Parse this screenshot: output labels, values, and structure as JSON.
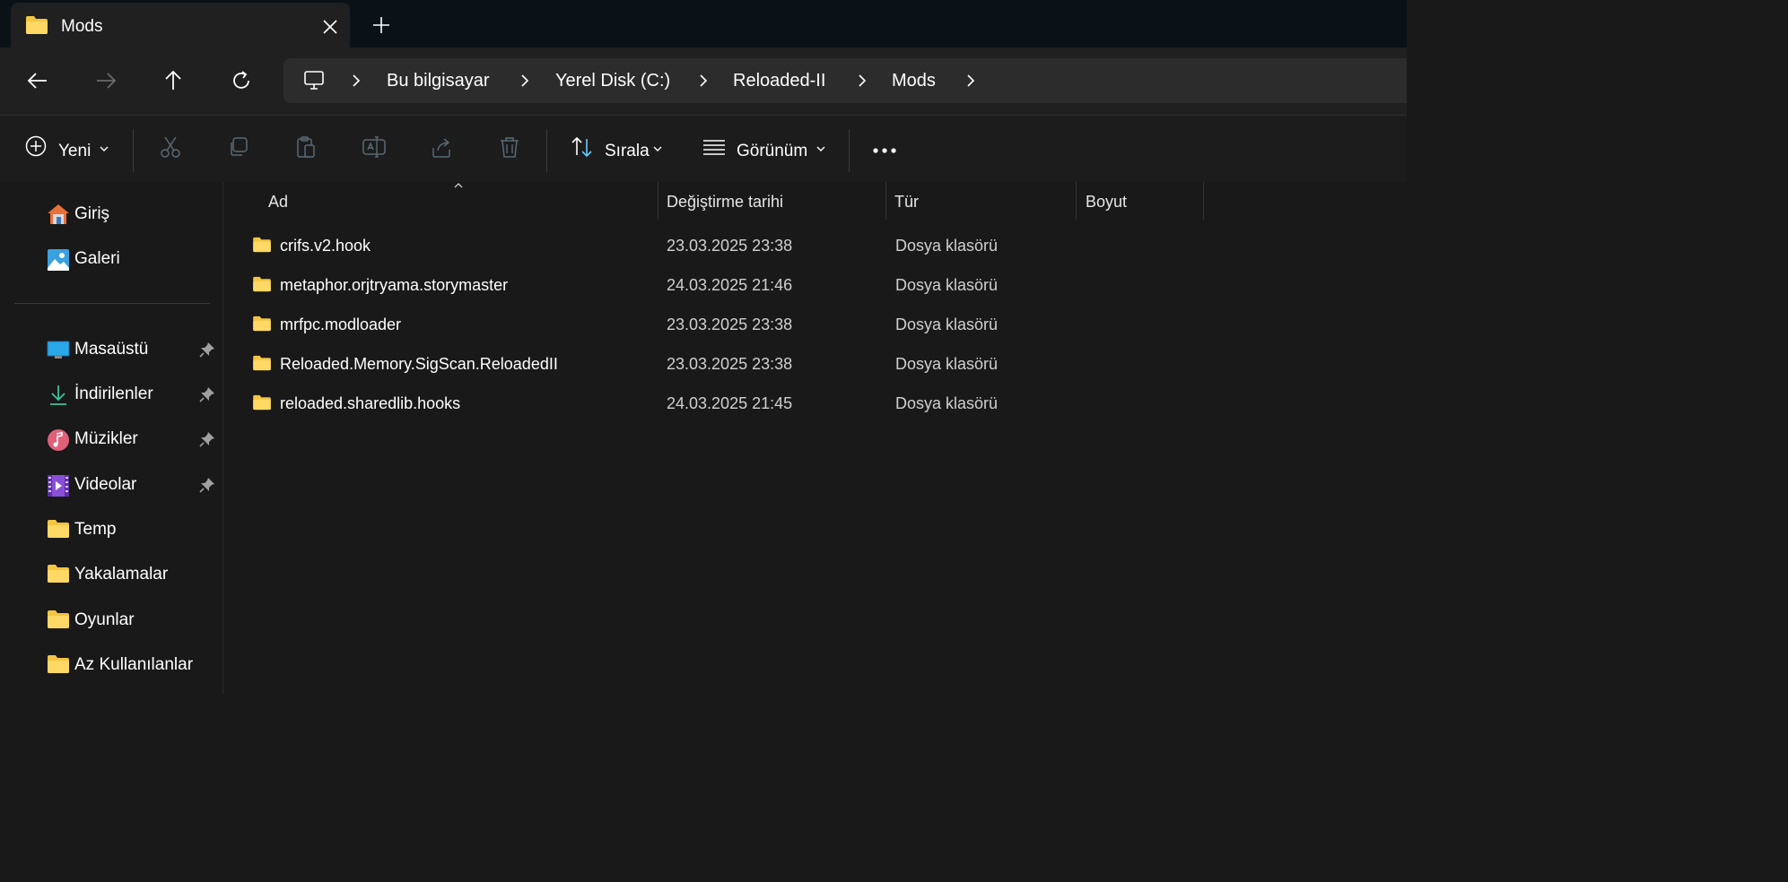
{
  "window": {
    "tab_title": "Mods"
  },
  "address_bar": {
    "crumbs": [
      "Bu bilgisayar",
      "Yerel Disk (C:)",
      "Reloaded-II",
      "Mods"
    ]
  },
  "toolbar": {
    "new_label": "Yeni",
    "sort_label": "Sırala",
    "view_label": "Görünüm"
  },
  "sidebar": {
    "top": [
      {
        "label": "Giriş",
        "icon": "home-icon"
      },
      {
        "label": "Galeri",
        "icon": "gallery-icon"
      }
    ],
    "pinned": [
      {
        "label": "Masaüstü",
        "icon": "desktop-icon"
      },
      {
        "label": "İndirilenler",
        "icon": "downloads-icon"
      },
      {
        "label": "Müzikler",
        "icon": "music-icon"
      },
      {
        "label": "Videolar",
        "icon": "videos-icon"
      },
      {
        "label": "Temp",
        "icon": "folder-icon"
      },
      {
        "label": "Yakalamalar",
        "icon": "folder-icon"
      },
      {
        "label": "Oyunlar",
        "icon": "folder-icon"
      },
      {
        "label": "Az Kullanılanlar",
        "icon": "folder-icon"
      }
    ]
  },
  "file_list": {
    "columns": [
      "Ad",
      "Değiştirme tarihi",
      "Tür",
      "Boyut"
    ],
    "rows": [
      {
        "name": "crifs.v2.hook",
        "date": "23.03.2025 23:38",
        "type": "Dosya klasörü"
      },
      {
        "name": "metaphor.orjtryama.storymaster",
        "date": "24.03.2025 21:46",
        "type": "Dosya klasörü"
      },
      {
        "name": "mrfpc.modloader",
        "date": "23.03.2025 23:38",
        "type": "Dosya klasörü"
      },
      {
        "name": "Reloaded.Memory.SigScan.ReloadedII",
        "date": "23.03.2025 23:38",
        "type": "Dosya klasörü"
      },
      {
        "name": "reloaded.sharedlib.hooks",
        "date": "24.03.2025 21:45",
        "type": "Dosya klasörü"
      }
    ]
  },
  "colors": {
    "folder": "#f4c542",
    "accent": "#60cdff"
  }
}
